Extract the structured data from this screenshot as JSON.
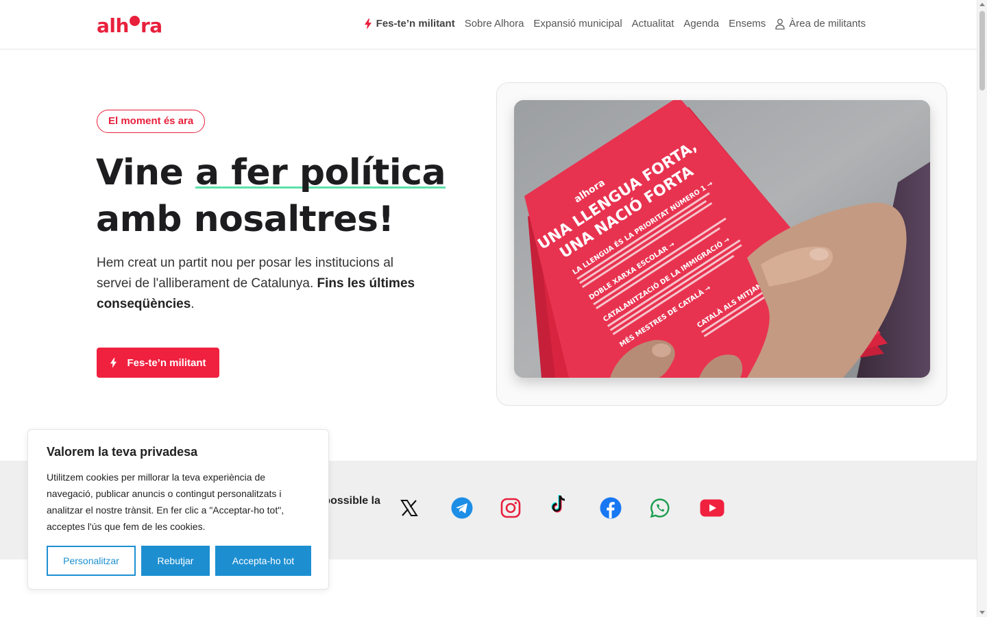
{
  "brand": {
    "logo_left": "alh",
    "logo_right": "ra",
    "accent_color": "#e8203c"
  },
  "nav": {
    "items": [
      {
        "label": "Fes-te’n militant",
        "icon": "bolt-icon"
      },
      {
        "label": "Sobre Alhora"
      },
      {
        "label": "Expansió municipal"
      },
      {
        "label": "Actualitat"
      },
      {
        "label": "Agenda"
      },
      {
        "label": "Ensems"
      },
      {
        "label": "Àrea de militants",
        "icon": "user-icon"
      }
    ]
  },
  "hero": {
    "badge": "El moment és ara",
    "title_part1": "Vine ",
    "title_underlined": "a fer política",
    "title_part2": "amb nosaltres!",
    "text_part1": "Hem creat un partit nou per posar les institucions al servei de l'alliberament de Catalunya. ",
    "text_bold": "Fins les últimes conseqüències",
    "text_end": ".",
    "cta_label": "Fes-te’n militant",
    "image": {
      "leaflet_logo": "alhora",
      "leaflet_headline_1": "UNA LLENGUA FORTA,",
      "leaflet_headline_2": "UNA NACIÓ FORTA",
      "leaflet_section_1": "LA LLENGUA ÉS LA PRIORITAT NÚMERO 1 →",
      "leaflet_section_2": "DOBLE XARXA ESCOLAR →",
      "leaflet_section_3": "CATALANITZACIÓ DE LA IMMIGRACIÓ →",
      "leaflet_section_4": "MÉS MESTRES DE CATALÀ →",
      "leaflet_section_5": "CATALÀ ALS MITJANS PÚBLICS →"
    }
  },
  "social": {
    "text": "Fes possible la",
    "icons": [
      "x-icon",
      "telegram-icon",
      "instagram-icon",
      "tiktok-icon",
      "facebook-icon",
      "whatsapp-icon",
      "youtube-icon"
    ]
  },
  "cookie": {
    "title": "Valorem la teva privadesa",
    "text": "Utilitzem cookies per millorar la teva experiència de navegació, publicar anuncis o contingut personalitzats i analitzar el nostre trànsit. En fer clic a \"Acceptar-ho tot\", acceptes l'ús que fem de les cookies.",
    "customize_label": "Personalitzar",
    "reject_label": "Rebutjar",
    "accept_label": "Accepta-ho tot",
    "button_color": "#1d8fd1"
  }
}
